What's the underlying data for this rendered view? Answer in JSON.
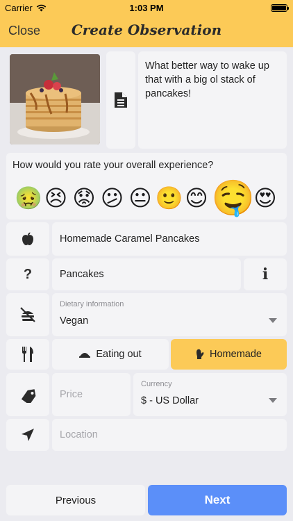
{
  "status_bar": {
    "carrier": "Carrier",
    "time": "1:03 PM"
  },
  "nav": {
    "close_label": "Close",
    "title": "Create Observation"
  },
  "photo": {
    "alt": "Photo of pancakes"
  },
  "notes": {
    "text": "What better way to wake up that with a big ol stack of pancakes!"
  },
  "rating": {
    "question": "How would you rate your overall experience?",
    "options": [
      "🤢",
      "😣",
      "😟",
      "😕",
      "😐",
      "🙂",
      "😊",
      "🤤",
      "😍"
    ],
    "selected_index": 7
  },
  "meal_name": {
    "value": "Homemade Caramel Pancakes"
  },
  "meal_type": {
    "value": "Pancakes"
  },
  "dietary": {
    "label": "Dietary information",
    "value": "Vegan"
  },
  "location_type": {
    "eating_out_label": "Eating out",
    "homemade_label": "Homemade",
    "selected": "Homemade"
  },
  "price": {
    "placeholder": "Price"
  },
  "currency": {
    "label": "Currency",
    "value": "$ - US Dollar"
  },
  "location": {
    "placeholder": "Location"
  },
  "footer": {
    "previous_label": "Previous",
    "next_label": "Next"
  },
  "colors": {
    "accent": "#fcca57",
    "primary": "#5b8ff9",
    "background": "#ebebf0",
    "card": "#f4f4f6"
  }
}
